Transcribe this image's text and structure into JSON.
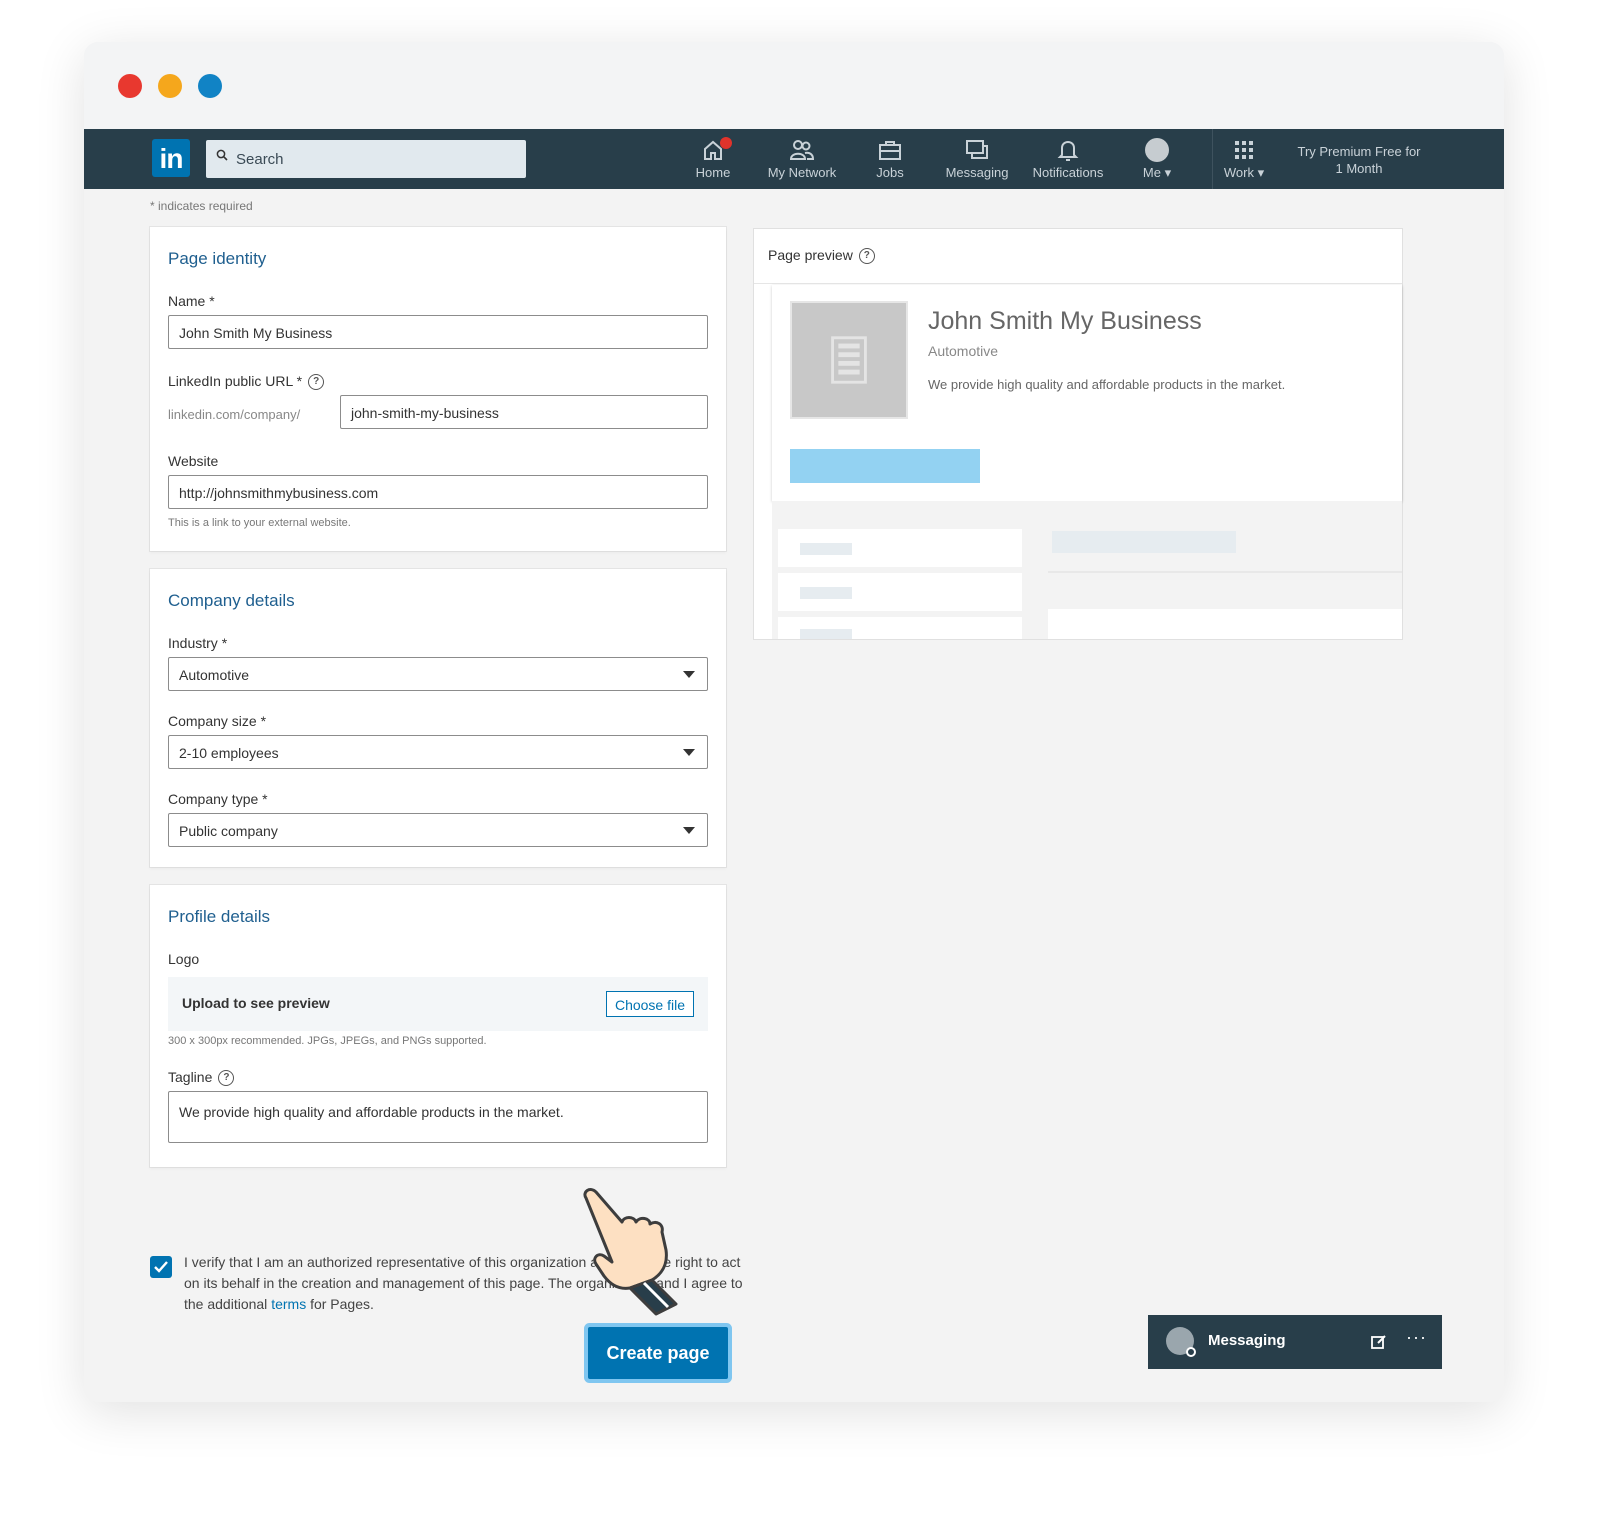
{
  "nav": {
    "logo": "in",
    "search_placeholder": "Search",
    "items": [
      {
        "label": "Home",
        "icon": "home-icon"
      },
      {
        "label": "My Network",
        "icon": "people-icon"
      },
      {
        "label": "Jobs",
        "icon": "briefcase-icon"
      },
      {
        "label": "Messaging",
        "icon": "chat-icon"
      },
      {
        "label": "Notifications",
        "icon": "bell-icon"
      },
      {
        "label": "Me",
        "icon": "avatar-icon"
      },
      {
        "label": "Work",
        "icon": "grid-icon"
      }
    ],
    "premium": "Try Premium Free for 1 Month"
  },
  "form": {
    "required_note": "* indicates required",
    "identity": {
      "title": "Page identity",
      "name_label": "Name",
      "name_value": "John Smith My Business",
      "url_label": "LinkedIn public URL",
      "url_prefix": "linkedin.com/company/",
      "url_value": "john-smith-my-business",
      "website_label": "Website",
      "website_value": "http://johnsmithmybusiness.com",
      "website_hint": "This is a link to your external website."
    },
    "company": {
      "title": "Company details",
      "industry_label": "Industry",
      "industry_value": "Automotive",
      "size_label": "Company size",
      "size_value": "2-10 employees",
      "type_label": "Company type",
      "type_value": "Public company"
    },
    "profile": {
      "title": "Profile details",
      "logo_label": "Logo",
      "upload_text": "Upload to see preview",
      "choose_file": "Choose file",
      "logo_hint": "300 x 300px recommended. JPGs, JPEGs, and PNGs supported.",
      "tagline_label": "Tagline",
      "tagline_value": "We provide high quality and affordable products in the market."
    },
    "verify": {
      "checked": true,
      "text_before": "I verify that I am an authorized representative of this organization and have the right to act on its behalf in the creation and management of this page. The organization and I agree to the additional ",
      "terms_link": "terms",
      "text_after": " for Pages."
    },
    "create_button": "Create page",
    "required_mark": "*"
  },
  "preview": {
    "header": "Page preview",
    "name": "John Smith My Business",
    "industry": "Automotive",
    "tagline": "We provide high quality and affordable products in the market."
  },
  "messaging": {
    "label": "Messaging",
    "more": "···"
  },
  "colors": {
    "brand": "#0073b1",
    "navbar": "#283e4a",
    "preview_button": "#93d2f2"
  }
}
